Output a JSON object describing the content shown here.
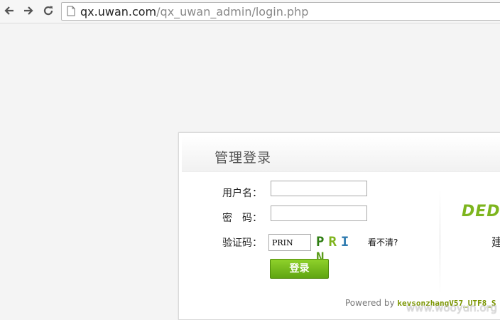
{
  "browser": {
    "url_host": "qx.uwan.com",
    "url_path": "/qx_uwan_admin/login.php"
  },
  "login": {
    "title": "管理登录",
    "username_label": "用户名：",
    "password_label": "密　码：",
    "captcha_label": "验证码：",
    "captcha_value": "PRIN",
    "captcha_image": [
      "P",
      "R",
      "I",
      "N"
    ],
    "refresh_link": "看不清?",
    "submit_label": "登录"
  },
  "brand": {
    "logo_text": "DED",
    "side_char": "建"
  },
  "footer": {
    "powered_prefix": "Powered by ",
    "powered_link": "kevsonzhangV57_UTF8_S"
  },
  "watermark": "www.wooyun.org",
  "colors": {
    "accent_green": "#6cb61a",
    "captcha_colors": [
      "#2e7d12",
      "#7fb41e",
      "#2f7bb0",
      "#5a9c18"
    ]
  }
}
